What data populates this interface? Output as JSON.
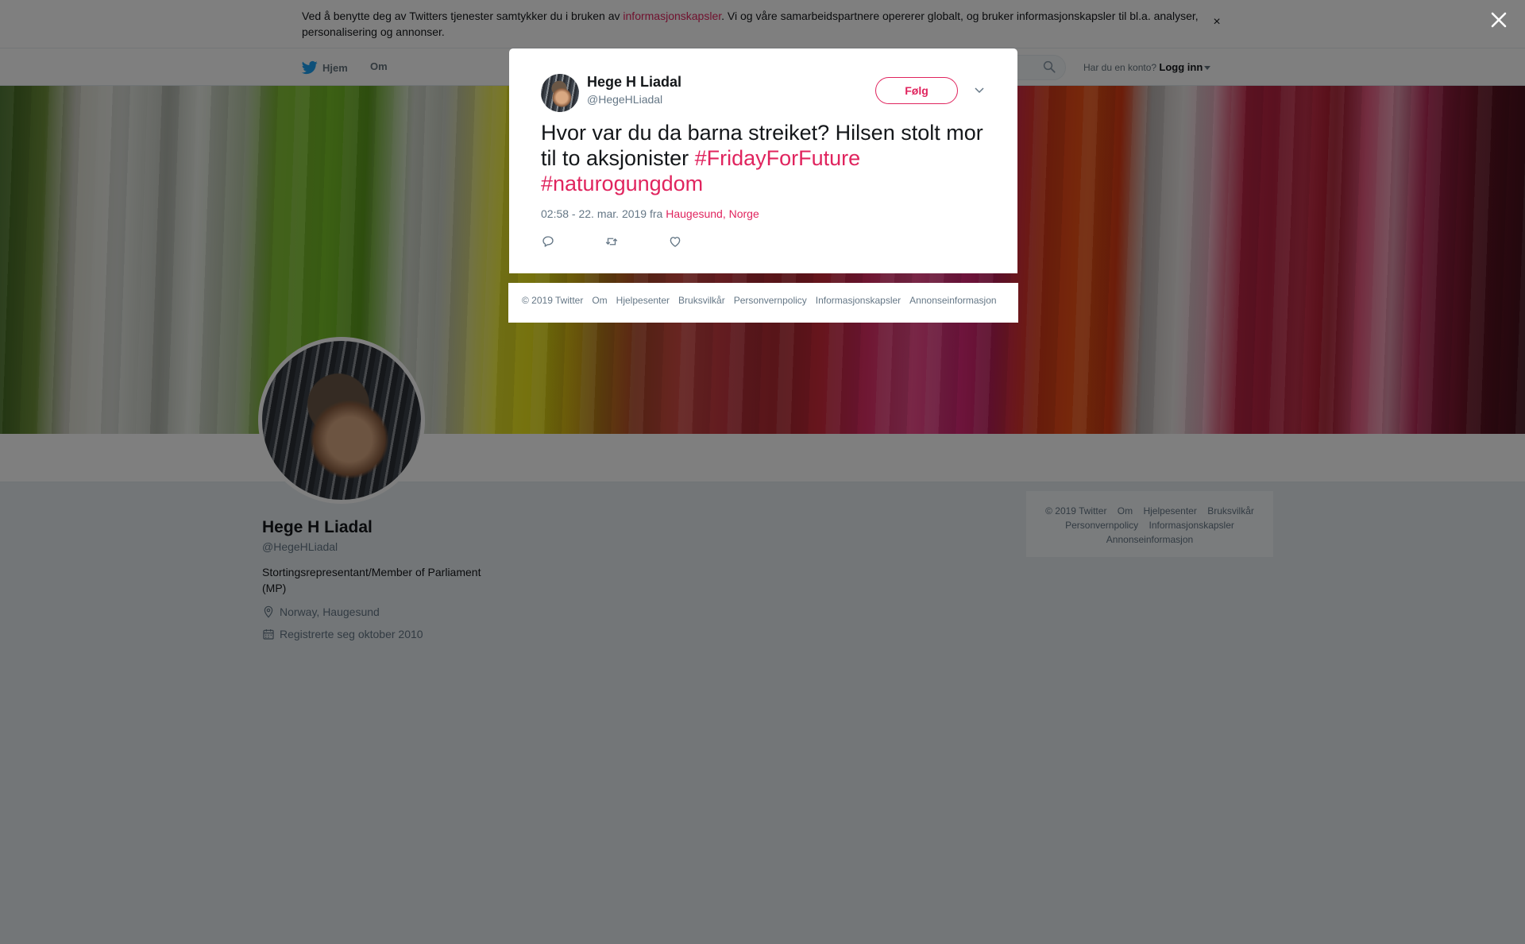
{
  "cookie_banner": {
    "text_before": "Ved å benytte deg av Twitters tjenester samtykker du i bruken av ",
    "link": "informasjonskapsler",
    "text_after": ". Vi og våre samarbeidspartnere opererer globalt, og bruker informasjonskapsler til bl.a. analyser, personalisering og annonser.",
    "close": "×"
  },
  "nav": {
    "home": "Hjem",
    "about": "Om",
    "search_placeholder": "",
    "account_prompt": "Har du en konto?",
    "login": "Logg inn"
  },
  "profile": {
    "name": "Hege H Liadal",
    "handle": "@HegeHLiadal",
    "bio": "Stortingsrepresentant/Member of Parliament (MP)",
    "location": "Norway, Haugesund",
    "joined": "Registrerte seg oktober 2010"
  },
  "side_footer": {
    "links": [
      "© 2019 Twitter",
      "Om",
      "Hjelpesenter",
      "Bruksvilkår",
      "Personvernpolicy",
      "Informasjonskapsler",
      "Annonseinformasjon"
    ]
  },
  "tweet": {
    "author_name": "Hege H Liadal",
    "author_handle": "@HegeHLiadal",
    "follow_label": "Følg",
    "text_plain": "Hvor var du da barna streiket? Hilsen stolt mor til to aksjonister ",
    "hashtag_1": "#FridayForFuture",
    "hashtag_2": "#naturogungdom",
    "timestamp": "02:58 - 22. mar. 2019 fra ",
    "location": "Haugesund, Norge"
  },
  "modal_footer": {
    "links": [
      "© 2019 Twitter",
      "Om",
      "Hjelpesenter",
      "Bruksvilkår",
      "Personvernpolicy",
      "Informasjonskapsler",
      "Annonseinformasjon"
    ]
  },
  "icons": {
    "overlay_close": "close-icon",
    "reply": "reply-icon",
    "retweet": "retweet-icon",
    "like": "heart-icon",
    "search": "search-icon",
    "twitter": "twitter-bird-icon"
  },
  "colors": {
    "accent": "#e0245e",
    "secondary_text": "#657786",
    "overlay": "rgba(0,0,0,0.5)"
  }
}
